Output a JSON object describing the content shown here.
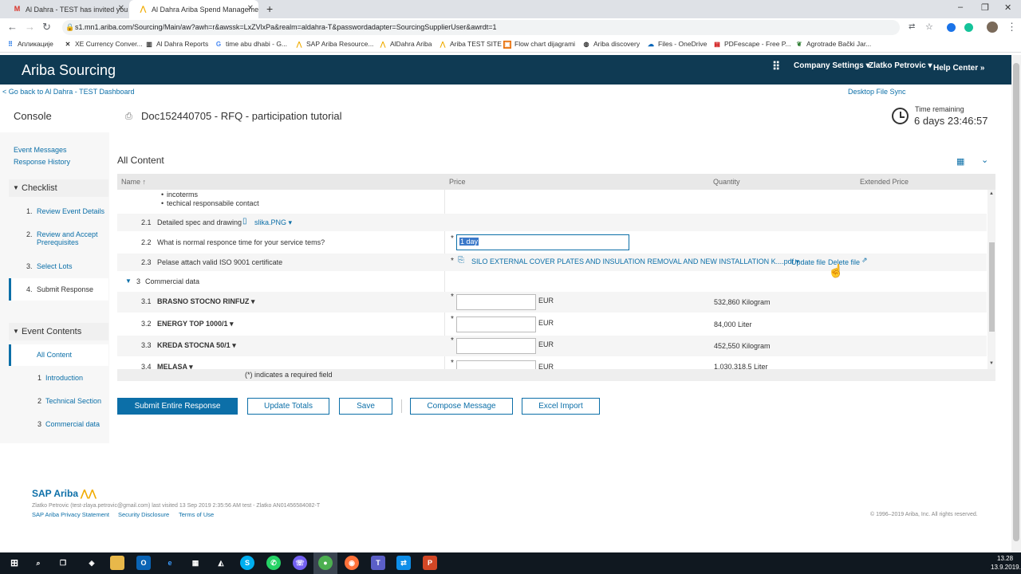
{
  "browser": {
    "tabs": [
      {
        "title": "Al Dahra - TEST has invited you t",
        "favicon": "gmail-icon"
      },
      {
        "title": "Al Dahra Ariba Spend Manageme",
        "favicon": "ariba-icon"
      }
    ],
    "url": "s1.mn1.ariba.com/Sourcing/Main/aw?awh=r&awssk=LxZVlxPa&realm=aldahra-T&passwordadapter=SourcingSupplierUser&awrdt=1",
    "bookmarks": [
      "Апликације",
      "XE Currency Conver...",
      "Al Dahra Reports",
      "time abu dhabi - G...",
      "SAP Ariba Resource...",
      "AlDahra Ariba",
      "Ariba TEST SITE",
      "Flow chart dijagrami",
      "Ariba discovery",
      "Files - OneDrive",
      "PDFescape - Free P...",
      "Agrotrade Bački Jar..."
    ]
  },
  "header": {
    "brand": "Ariba Sourcing",
    "company_settings": "Company Settings ▾",
    "user": "Zlatko Petrovic ▾",
    "help": "Help Center »"
  },
  "topbar": {
    "back_link": "< Go back to Al Dahra - TEST Dashboard",
    "desktop_sync": "Desktop File Sync"
  },
  "console_label": "Console",
  "doc_title": "Doc152440705 - RFQ - participation tutorial",
  "time": {
    "label": "Time remaining",
    "value": "6 days 23:46:57"
  },
  "left_nav": {
    "event_messages": "Event Messages",
    "response_history": "Response History",
    "checklist_title": "Checklist",
    "checklist": [
      {
        "n": "1.",
        "label": "Review Event Details"
      },
      {
        "n": "2.",
        "label": "Review and Accept Prerequisites"
      },
      {
        "n": "3.",
        "label": "Select Lots"
      },
      {
        "n": "4.",
        "label": "Submit Response"
      }
    ],
    "event_contents_title": "Event Contents",
    "all_content": "All Content",
    "contents": [
      {
        "n": "1",
        "label": "Introduction"
      },
      {
        "n": "2",
        "label": "Technical Section"
      },
      {
        "n": "3",
        "label": "Commercial data"
      }
    ]
  },
  "content": {
    "title": "All Content",
    "columns": {
      "name": "Name ↑",
      "price": "Price",
      "quantity": "Quantity",
      "extended": "Extended Price"
    },
    "bullets": [
      "incoterms",
      "techical responsabile contact"
    ],
    "rows": {
      "r21": {
        "num": "2.1",
        "name": "Detailed spec and drawing",
        "file": "slika.PNG ▾"
      },
      "r22": {
        "num": "2.2",
        "name": "What is normal responce time for your service tems?",
        "value": "1 day"
      },
      "r23": {
        "num": "2.3",
        "name": "Pelase attach valid ISO 9001 certificate",
        "file": "SILO EXTERNAL COVER PLATES AND INSULATION REMOVAL AND NEW INSTALLATION K....pdf ▾",
        "update": "Update file",
        "delete": "Delete file"
      },
      "s3": {
        "num": "3",
        "name": "Commercial data"
      },
      "r31": {
        "num": "3.1",
        "name": "BRASNO STOCNO RINFUZ ▾",
        "currency": "EUR",
        "qty": "532,860 Kilogram"
      },
      "r32": {
        "num": "3.2",
        "name": "ENERGY TOP 1000/1 ▾",
        "currency": "EUR",
        "qty": "84,000 Liter"
      },
      "r33": {
        "num": "3.3",
        "name": "KREDA STOCNA 50/1 ▾",
        "currency": "EUR",
        "qty": "452,550 Kilogram"
      },
      "r34": {
        "num": "3.4",
        "name": "MELASA ▾",
        "currency": "EUR",
        "qty": "1,030,318.5 Liter"
      }
    },
    "required_note": "(*) indicates a required field"
  },
  "buttons": {
    "submit": "Submit Entire Response",
    "update": "Update Totals",
    "save": "Save",
    "compose": "Compose Message",
    "excel": "Excel Import"
  },
  "footer": {
    "logo": "SAP Ariba",
    "visited": "Zlatko Petrovic (test-zlaya.petrovic@gmail.com) last visited 13 Sep 2019 2:35:56 AM  test - Zlatko  AN01456584082-T",
    "privacy": "SAP Ariba Privacy Statement",
    "security": "Security Disclosure",
    "terms": "Terms of Use",
    "copyright": "© 1996–2019 Ariba, Inc. All rights reserved."
  },
  "taskbar": {
    "time": "13.28",
    "date": "13.9.2019."
  },
  "colors": {
    "header": "#0f3a53",
    "link": "#0c6fa8",
    "primary": "#0c6fa8"
  }
}
